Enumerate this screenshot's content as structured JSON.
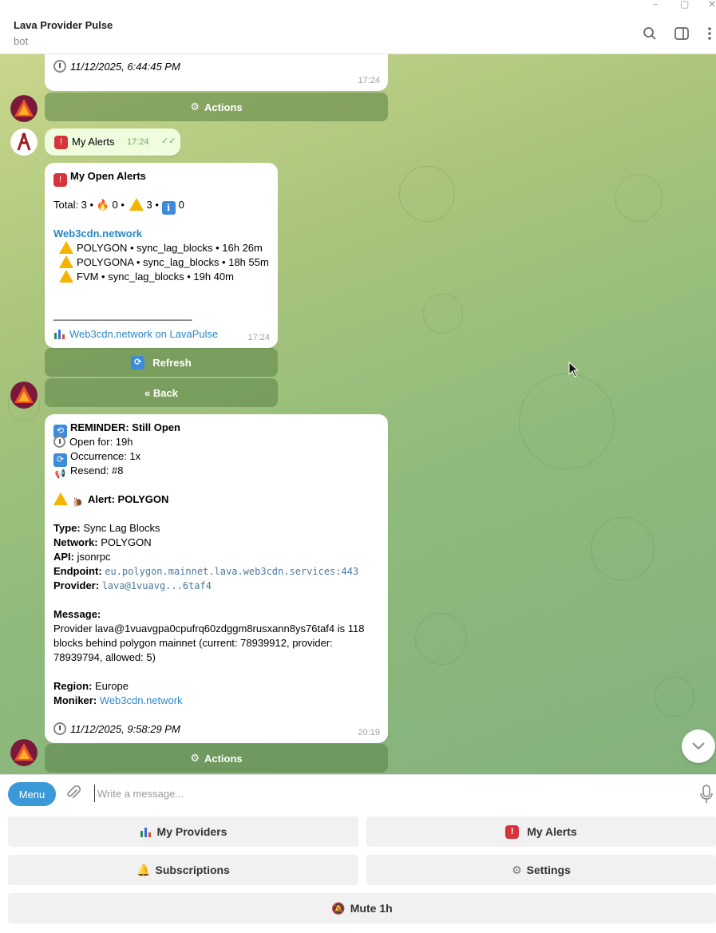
{
  "window": {
    "minimize": "–",
    "maximize": "▢",
    "close": "✕"
  },
  "header": {
    "title": "Lava Provider Pulse",
    "subtitle": "bot"
  },
  "messages": {
    "first_timestamp": "11/12/2025, 6:44:45 PM",
    "first_time": "17:24",
    "actions_label": "Actions",
    "user_message": "My Alerts",
    "user_time": "17:24",
    "open_alerts": {
      "title": "My Open Alerts",
      "total_label": "Total: 3 •",
      "fire_count": "0 •",
      "warn_count": "3 •",
      "info_count": "0",
      "network": "Web3cdn.network",
      "items": [
        "POLYGON • sync_lag_blocks • 16h 26m",
        "POLYGONA • sync_lag_blocks • 18h 55m",
        "FVM • sync_lag_blocks • 19h 40m"
      ],
      "divider": "________________________",
      "footer_link": "Web3cdn.network on LavaPulse",
      "time": "17:24",
      "refresh_label": "Refresh",
      "back_label": "« Back"
    },
    "reminder": {
      "title": "REMINDER: Still Open",
      "open_for": "Open for: 19h",
      "occurrence": "Occurrence: 1x",
      "resend": "Resend: #8",
      "alert_title": "Alert: POLYGON",
      "type_label": "Type:",
      "type_value": "Sync Lag Blocks",
      "network_label": "Network:",
      "network_value": "POLYGON",
      "api_label": "API:",
      "api_value": "jsonrpc",
      "endpoint_label": "Endpoint:",
      "endpoint_value": "eu.polygon.mainnet.lava.web3cdn.services:443",
      "provider_label": "Provider:",
      "provider_value": "lava@1vuavg...6taf4",
      "message_label": "Message:",
      "message_line1": "Provider lava@1vuavgpa0cpufrq60zdggm8rusxann8ys76taf4 is 118",
      "message_line2": "blocks behind polygon mainnet (current: 78939912, provider:",
      "message_line3": "78939794, allowed: 5)",
      "region_label": "Region:",
      "region_value": "Europe",
      "moniker_label": "Moniker:",
      "moniker_value": "Web3cdn.network",
      "timestamp": "11/12/2025, 9:58:29 PM",
      "time": "20:19",
      "actions_label": "Actions"
    }
  },
  "composer": {
    "menu_label": "Menu",
    "placeholder": "Write a message..."
  },
  "keyboard": {
    "my_providers": "My Providers",
    "my_alerts": "My Alerts",
    "subscriptions": "Subscriptions",
    "settings": "Settings",
    "mute": "Mute 1h"
  },
  "colors": {
    "accent": "#3a99d8",
    "link": "#2a88c8",
    "inline_button": "#6a9a55",
    "out_bubble": "#effdde"
  }
}
